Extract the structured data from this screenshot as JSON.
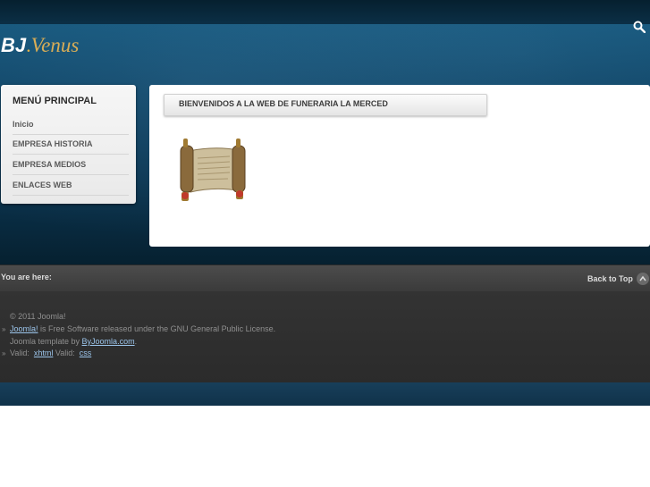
{
  "header": {
    "logo_bj": "BJ",
    "logo_dot": ".",
    "logo_venus": "Venus",
    "search_icon": "search-icon"
  },
  "sidebar": {
    "title": "MENÚ PRINCIPAL",
    "items": [
      {
        "label": "Inicio"
      },
      {
        "label": "EMPRESA HISTORIA"
      },
      {
        "label": "EMPRESA MEDIOS"
      },
      {
        "label": "ENLACES WEB"
      }
    ]
  },
  "main": {
    "welcome": "BIENVENIDOS A LA WEB DE FUNERARIA LA MERCED",
    "image_icon": "scroll-image"
  },
  "breadcrumb": {
    "label": "You are here:",
    "back_to_top": "Back to Top"
  },
  "footer": {
    "copyright": "© 2011 Joomla!",
    "joomla_link": "Joomla!",
    "license_text": " is Free Software released under the GNU General Public License.",
    "template_text": "Joomla template by ",
    "template_link": "ByJoomla.com",
    "template_end": ".",
    "valid_label": "Valid:",
    "xhtml_link": "xhtml",
    "valid_label2": " Valid:",
    "css_link": "css"
  },
  "colors": {
    "header_blue": "#14557a",
    "footer_dark": "#2e2e2e",
    "link_blue": "#9bc4ea",
    "logo_gold": "#d9ad56"
  }
}
